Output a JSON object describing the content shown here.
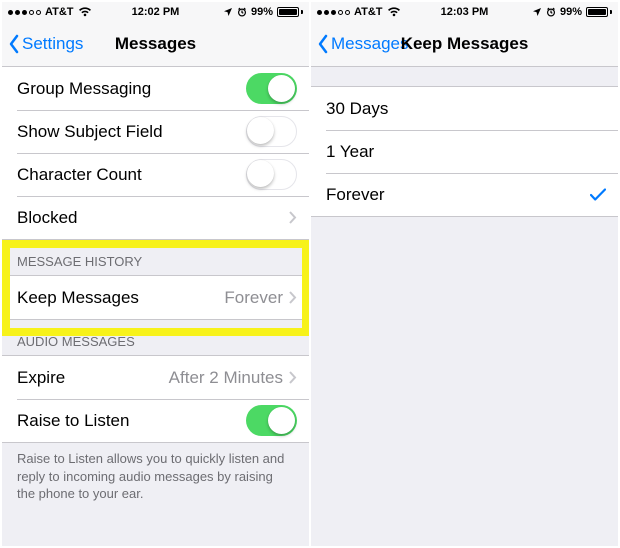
{
  "left": {
    "status": {
      "carrier": "AT&T",
      "time": "12:02 PM",
      "batteryPct": "99%"
    },
    "nav": {
      "back": "Settings",
      "title": "Messages"
    },
    "groupMessaging": "Group Messaging",
    "showSubject": "Show Subject Field",
    "charCount": "Character Count",
    "blocked": "Blocked",
    "historyHeader": "MESSAGE HISTORY",
    "keepMessages": "Keep Messages",
    "keepValue": "Forever",
    "audioHeader": "AUDIO MESSAGES",
    "expire": "Expire",
    "expireValue": "After 2 Minutes",
    "raise": "Raise to Listen",
    "raiseFooter": "Raise to Listen allows you to quickly listen and reply to incoming audio messages by raising the phone to your ear."
  },
  "right": {
    "status": {
      "carrier": "AT&T",
      "time": "12:03 PM",
      "batteryPct": "99%"
    },
    "nav": {
      "back": "Messages",
      "title": "Keep Messages"
    },
    "opt30": "30 Days",
    "opt1y": "1 Year",
    "optForever": "Forever"
  }
}
